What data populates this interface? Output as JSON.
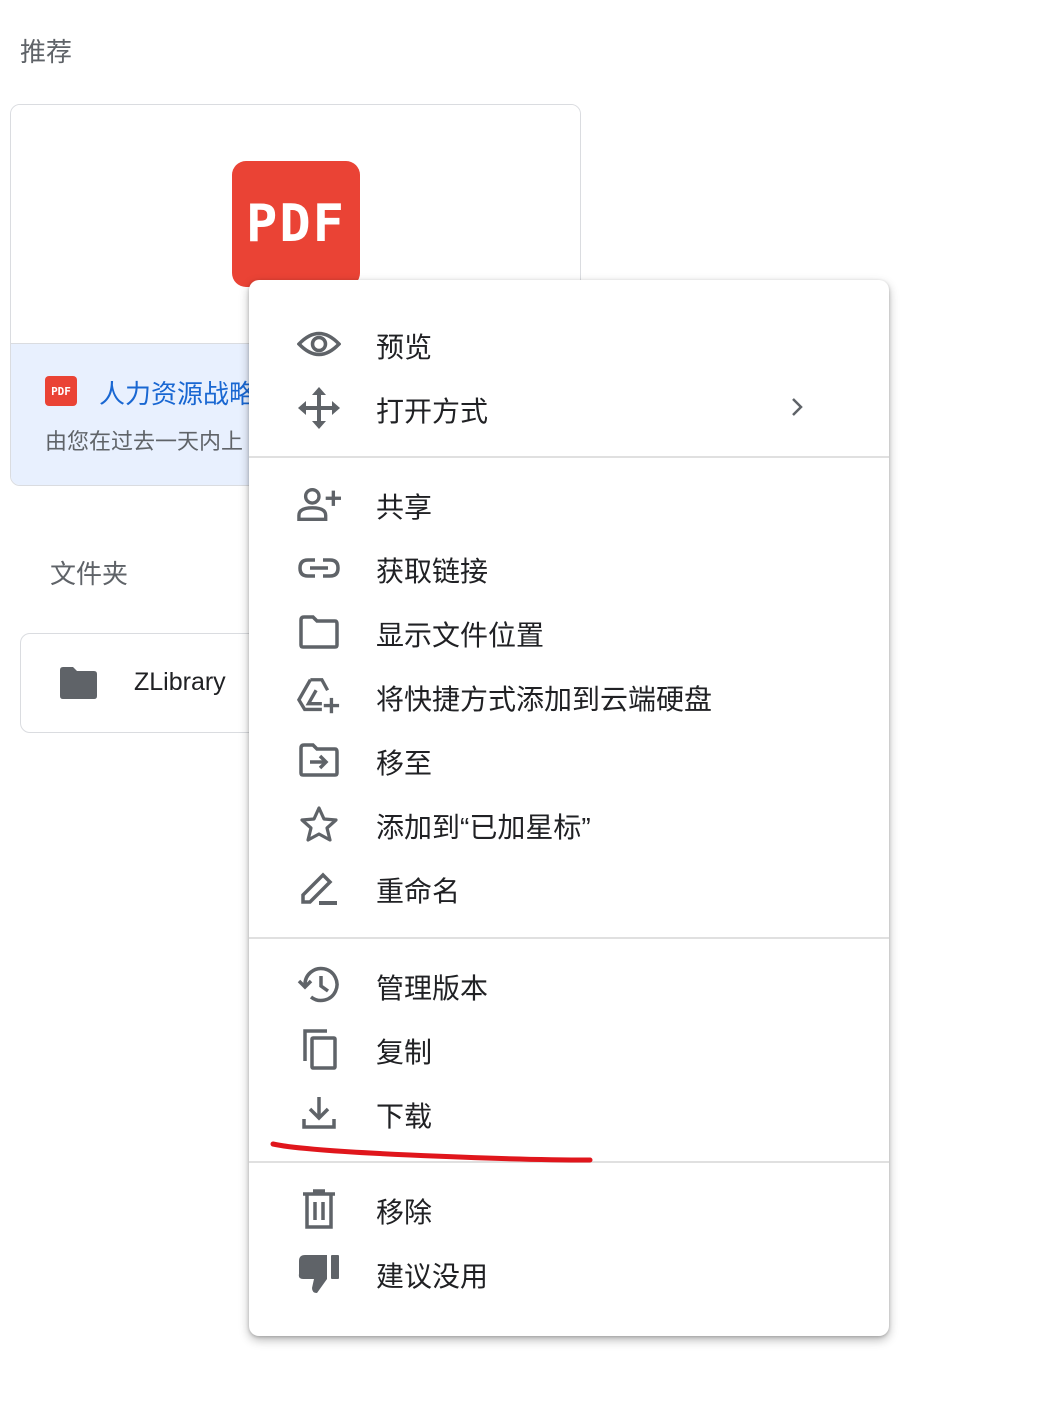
{
  "sections": {
    "recommended": "推荐",
    "folders": "文件夹"
  },
  "file_card": {
    "thumb_badge": "PDF",
    "icon_badge": "PDF",
    "name": "人力资源战略",
    "subtitle": "由您在过去一天内上"
  },
  "folder_card": {
    "name": "ZLibrary"
  },
  "menu": {
    "items": [
      {
        "label": "预览",
        "icon": "eye-icon"
      },
      {
        "label": "打开方式",
        "icon": "move-arrows-icon"
      },
      {
        "label": "共享",
        "icon": "person-add-icon"
      },
      {
        "label": "获取链接",
        "icon": "link-icon"
      },
      {
        "label": "显示文件位置",
        "icon": "folder-outline-icon"
      },
      {
        "label": "将快捷方式添加到云端硬盘",
        "icon": "drive-add-shortcut-icon"
      },
      {
        "label": "移至",
        "icon": "folder-move-icon"
      },
      {
        "label": "添加到“已加星标”",
        "icon": "star-outline-icon"
      },
      {
        "label": "重命名",
        "icon": "pencil-icon"
      },
      {
        "label": "管理版本",
        "icon": "history-icon"
      },
      {
        "label": "复制",
        "icon": "copy-icon"
      },
      {
        "label": "下载",
        "icon": "download-icon"
      },
      {
        "label": "移除",
        "icon": "trash-icon"
      },
      {
        "label": "建议没用",
        "icon": "thumb-down-icon"
      }
    ]
  },
  "colors": {
    "pdf_red": "#ea4335",
    "link_blue": "#1967d2",
    "info_bg": "#e8f0fe",
    "annotation_red": "#e0161c",
    "icon_gray": "#5f6368"
  }
}
